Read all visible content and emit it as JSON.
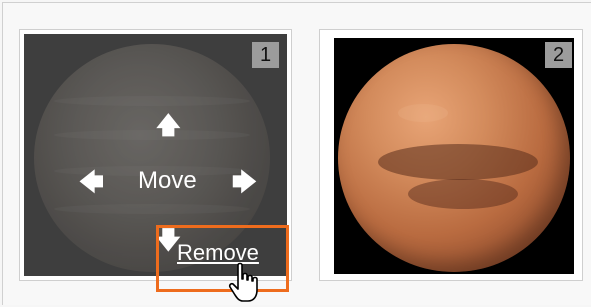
{
  "thumbnails": [
    {
      "number": "1",
      "image_label": "Jupiter",
      "controls": {
        "move_label": "Move",
        "remove_label": "Remove",
        "arrow_up": "🡅",
        "arrow_down": "🡇",
        "arrow_left": "🡄",
        "arrow_right": "🡆"
      }
    },
    {
      "number": "2",
      "image_label": "Mars"
    }
  ],
  "highlight_color": "#ee6c1d",
  "icons": {
    "cursor": "hand-pointer-icon",
    "arrows": [
      "arrow-up-icon",
      "arrow-down-icon",
      "arrow-left-icon",
      "arrow-right-icon"
    ]
  }
}
